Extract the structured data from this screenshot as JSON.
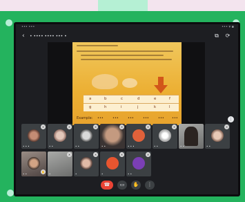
{
  "app": {
    "title": "• •••• •••• ••• •"
  },
  "status": {
    "left": "••• •••",
    "right": "••• ▾ ▪"
  },
  "slide": {
    "foot": "Example:",
    "row1": [
      "a",
      "b",
      "c",
      "d",
      "e",
      "f"
    ],
    "row2": [
      "g",
      "h",
      "i",
      "j",
      "k",
      "l"
    ],
    "row3": [
      "•••",
      "•••",
      "•••",
      "•••",
      "•••",
      "•••"
    ]
  },
  "participants": [
    {
      "name": "• • •"
    },
    {
      "name": "• •"
    },
    {
      "name": "• •"
    },
    {
      "name": "• •"
    },
    {
      "name": "• • •"
    },
    {
      "name": "• •"
    },
    {
      "name": "• •"
    },
    {
      "name": "• •"
    },
    {
      "name": "• •"
    },
    {
      "name": "•"
    },
    {
      "name": "•"
    },
    {
      "name": "•"
    },
    {
      "name": "• •"
    }
  ],
  "icons": {
    "back": "back-arrow-icon",
    "copy": "copy-link-icon",
    "camera_switch": "camera-switch-icon",
    "end": "end-call-icon",
    "video": "video-icon",
    "hand": "raise-hand-icon",
    "more": "more-options-icon"
  },
  "colors": {
    "frame": "#24b35e",
    "end_call": "#ea4335",
    "slide": "#ecaf33",
    "arrow": "#d2561a"
  }
}
